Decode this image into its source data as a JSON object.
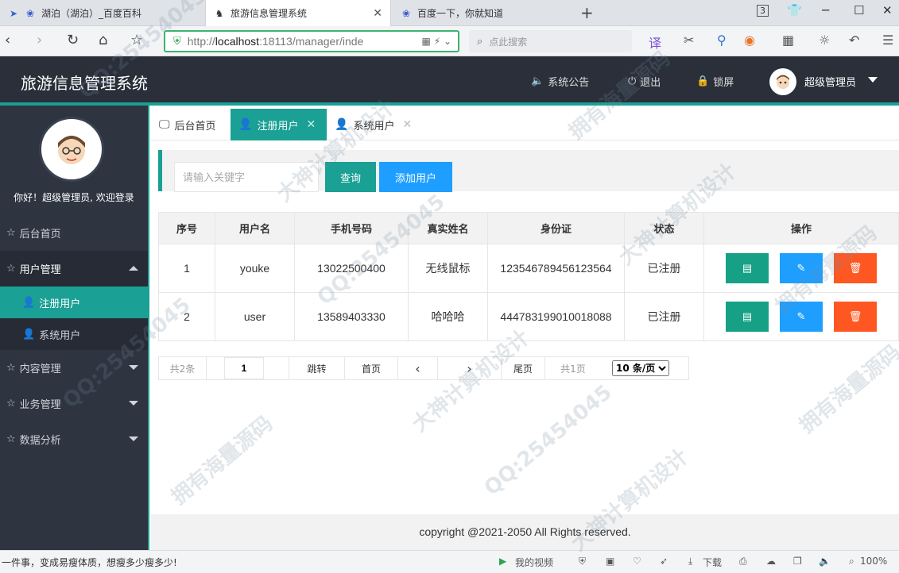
{
  "browser": {
    "tabs": [
      {
        "title": "湖泊（湖泊）_百度百科",
        "icon": "paw-icon"
      },
      {
        "title": "旅游信息管理系统",
        "icon": "antelope-icon"
      },
      {
        "title": "百度一下，你就知道",
        "icon": "paw-icon"
      }
    ],
    "url_scheme": "http://",
    "url_host": "localhost",
    "url_rest": ":18113/manager/inde",
    "search_placeholder": "点此搜索",
    "tab_count": "3",
    "status_ticker": "一件事，变成易瘦体质，想瘦多少瘦多少!",
    "status_video": "我的视频",
    "status_download": "下载",
    "zoom": "100%"
  },
  "app": {
    "title": "旅游信息管理系统",
    "announce": "系统公告",
    "logout": "退出",
    "lock": "锁屏",
    "user": "超级管理员"
  },
  "sidebar": {
    "greeting": "你好！超级管理员, 欢迎登录",
    "items": [
      {
        "label": "后台首页"
      },
      {
        "label": "用户管理"
      },
      {
        "label": "内容管理"
      },
      {
        "label": "业务管理"
      },
      {
        "label": "数据分析"
      }
    ],
    "subitems": [
      {
        "label": "注册用户"
      },
      {
        "label": "系统用户"
      }
    ]
  },
  "content_tabs": [
    {
      "label": "后台首页"
    },
    {
      "label": "注册用户"
    },
    {
      "label": "系统用户"
    }
  ],
  "search": {
    "placeholder": "请输入关键字",
    "query_label": "查询",
    "add_label": "添加用户"
  },
  "table": {
    "headers": [
      "序号",
      "用户名",
      "手机号码",
      "真实姓名",
      "身份证",
      "状态",
      "操作"
    ],
    "rows": [
      [
        "1",
        "youke",
        "13022500400",
        "无线鼠标",
        "123546789456123564",
        "已注册"
      ],
      [
        "2",
        "user",
        "13589403330",
        "哈哈哈",
        "444783199010018088",
        "已注册"
      ]
    ]
  },
  "pager": {
    "total": "共2条",
    "page": "1",
    "jump": "跳转",
    "first": "首页",
    "last": "尾页",
    "pages": "共1页",
    "page_size": "10 条/页"
  },
  "footer": "copyright @2021-2050 All Rights reserved.",
  "watermarks": [
    "QQ:25454045",
    "大神计算机设计",
    "拥有海量源码",
    "QQ:25454045",
    "大神计算机设计",
    "拥有海量源码",
    "QQ:25454045",
    "大神计算机设计",
    "拥有海量源码",
    "QQ:25454045",
    "大神计算机设计",
    "拥有海量源码"
  ],
  "colors": {
    "accent": "#1aa094",
    "header": "#2a2f3a",
    "sidebar": "#2e3440",
    "blue": "#1e9fff",
    "danger": "#ff5722"
  }
}
